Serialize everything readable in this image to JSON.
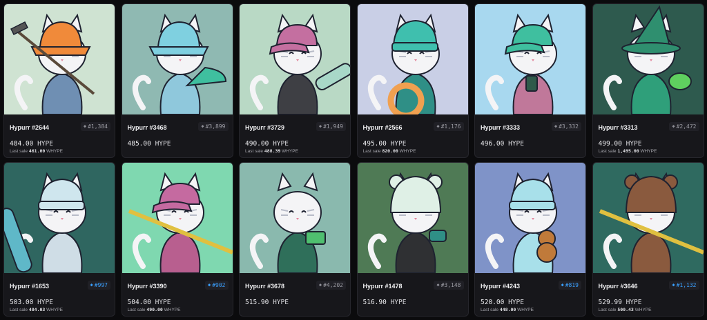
{
  "cards": [
    {
      "name": "Hypurr #2644",
      "rank": "#1,384",
      "rank_color": "gray",
      "price": "484.00",
      "unit": "HYPE",
      "last_sale_label": "Last sale",
      "last_sale_value": "461.00",
      "last_sale_unit": "WHYPE",
      "bg": "#cfe3d2",
      "hat": "#f08a3a",
      "hat_type": "bucket",
      "body": "#6f8fb3",
      "item": "rake"
    },
    {
      "name": "Hypurr #3468",
      "rank": "#3,899",
      "rank_color": "gray",
      "price": "485.00",
      "unit": "HYPE",
      "last_sale_label": "",
      "last_sale_value": "",
      "last_sale_unit": "",
      "bg": "#8fb9b2",
      "hat": "#7fd0e0",
      "hat_type": "bucket",
      "body": "#8fc8dc",
      "item": "fan"
    },
    {
      "name": "Hypurr #3729",
      "rank": "#1,949",
      "rank_color": "gray",
      "price": "490.00",
      "unit": "HYPE",
      "last_sale_label": "Last sale",
      "last_sale_value": "488.39",
      "last_sale_unit": "WHYPE",
      "bg": "#b9d9c5",
      "hat": "#c46fa0",
      "hat_type": "cap",
      "body": "#3e3f44",
      "item": "board"
    },
    {
      "name": "Hypurr #2566",
      "rank": "#1,176",
      "rank_color": "gray",
      "price": "495.00",
      "unit": "HYPE",
      "last_sale_label": "Last sale",
      "last_sale_value": "820.00",
      "last_sale_unit": "WHYPE",
      "bg": "#c9cfe6",
      "hat": "#3fbfae",
      "hat_type": "beanie",
      "body": "#2f8f86",
      "item": "ring"
    },
    {
      "name": "Hypurr #3333",
      "rank": "#3,332",
      "rank_color": "gray",
      "price": "496.00",
      "unit": "HYPE",
      "last_sale_label": "",
      "last_sale_value": "",
      "last_sale_unit": "",
      "bg": "#a8d8ef",
      "hat": "#3fbf9f",
      "hat_type": "cap",
      "body": "#c0789a",
      "item": "cup"
    },
    {
      "name": "Hypurr #3313",
      "rank": "#2,472",
      "rank_color": "gray",
      "price": "499.00",
      "unit": "HYPE",
      "last_sale_label": "Last sale",
      "last_sale_value": "1,495.00",
      "last_sale_unit": "WHYPE",
      "bg": "#2e5a4e",
      "hat": "#2f8f6f",
      "hat_type": "wizard",
      "body": "#2f9f7a",
      "item": "frog"
    },
    {
      "name": "Hypurr #1653",
      "rank": "#997",
      "rank_color": "blue",
      "price": "503.00",
      "unit": "HYPE",
      "last_sale_label": "Last sale",
      "last_sale_value": "484.03",
      "last_sale_unit": "WHYPE",
      "bg": "#2f6660",
      "hat": "#cfe6ee",
      "hat_type": "beanie",
      "body": "#cfdde6",
      "item": "skate"
    },
    {
      "name": "Hypurr #3390",
      "rank": "#902",
      "rank_color": "blue",
      "price": "504.00",
      "unit": "HYPE",
      "last_sale_label": "Last sale",
      "last_sale_value": "490.00",
      "last_sale_unit": "WHYPE",
      "bg": "#7fd8b0",
      "hat": "#c56aa0",
      "hat_type": "cap",
      "body": "#b85f8f",
      "item": "skis"
    },
    {
      "name": "Hypurr #3678",
      "rank": "#4,202",
      "rank_color": "gray",
      "price": "515.90",
      "unit": "HYPE",
      "last_sale_label": "",
      "last_sale_value": "",
      "last_sale_unit": "",
      "bg": "#8ab9ae",
      "hat": "none",
      "hat_type": "none",
      "body": "#2f6f5a",
      "item": "cash"
    },
    {
      "name": "Hypurr #1478",
      "rank": "#3,148",
      "rank_color": "gray",
      "price": "516.90",
      "unit": "HYPE",
      "last_sale_label": "",
      "last_sale_value": "",
      "last_sale_unit": "",
      "bg": "#4f7a55",
      "hat": "#dff0e6",
      "hat_type": "bear",
      "body": "#2f3033",
      "item": "phone"
    },
    {
      "name": "Hypurr #4243",
      "rank": "#819",
      "rank_color": "blue",
      "price": "520.00",
      "unit": "HYPE",
      "last_sale_label": "Last sale",
      "last_sale_value": "448.00",
      "last_sale_unit": "WHYPE",
      "bg": "#7f93c8",
      "hat": "#a8e0ea",
      "hat_type": "beanie",
      "body": "#a8e0ea",
      "item": "teddy"
    },
    {
      "name": "Hypurr #3646",
      "rank": "#1,132",
      "rank_color": "blue",
      "price": "529.99",
      "unit": "HYPE",
      "last_sale_label": "Last sale",
      "last_sale_value": "500.43",
      "last_sale_unit": "WHYPE",
      "bg": "#2f6a60",
      "hat": "#8a5a3e",
      "hat_type": "bear",
      "body": "#8a5a3e",
      "item": "skis"
    }
  ]
}
